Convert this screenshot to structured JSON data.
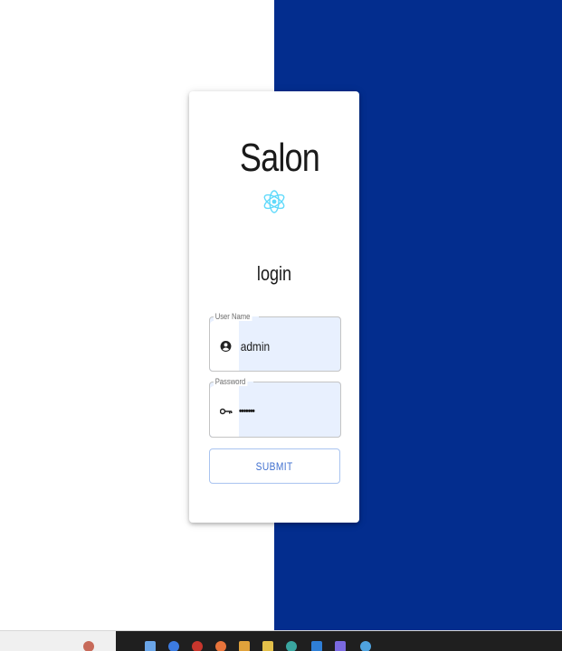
{
  "app": {
    "title": "Salon",
    "logo_icon": "react-icon",
    "logo_color": "#61dafb"
  },
  "login": {
    "heading": "login",
    "username": {
      "label": "User Name",
      "value": "admin",
      "icon": "account-circle-icon"
    },
    "password": {
      "label": "Password",
      "value": "•••••••",
      "icon": "key-icon"
    },
    "submit_label": "SUBMIT"
  },
  "colors": {
    "right_panel": "#032d8e",
    "autofill": "#e8f0fe",
    "submit_text": "#3f6fcf"
  }
}
